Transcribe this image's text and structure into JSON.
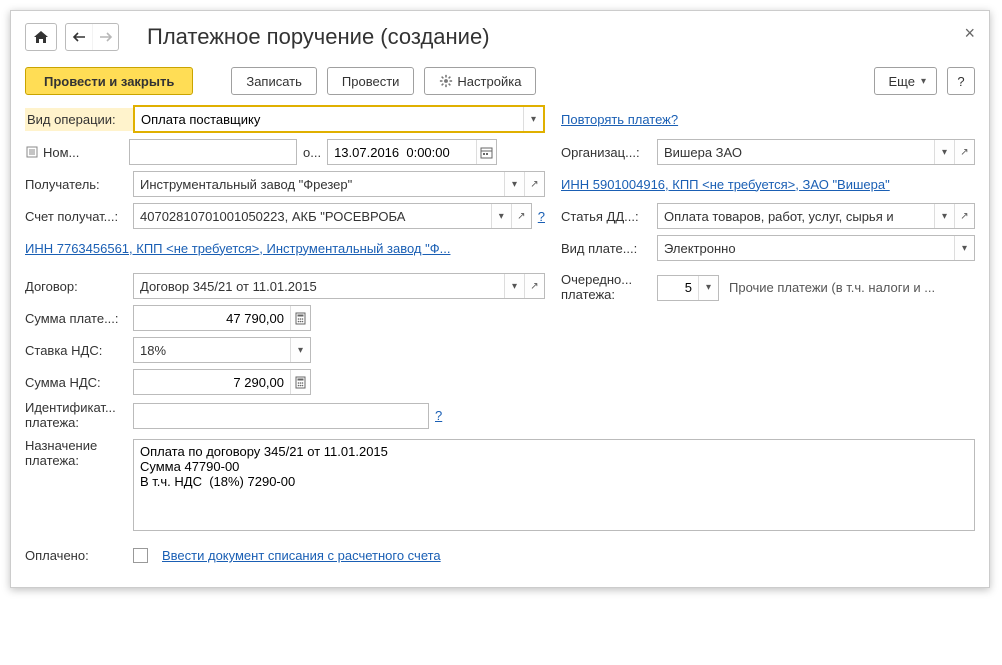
{
  "header": {
    "title": "Платежное поручение (создание)"
  },
  "toolbar": {
    "post_close": "Провести и закрыть",
    "save": "Записать",
    "post": "Провести",
    "settings": "Настройка",
    "more": "Еще",
    "help": "?"
  },
  "left": {
    "operation_label": "Вид операции:",
    "operation_value": "Оплата поставщику",
    "number_label": "Ном...",
    "number_value": "",
    "from_label": "о...",
    "date_value": "13.07.2016  0:00:00",
    "recipient_label": "Получатель:",
    "recipient_value": "Инструментальный завод \"Фрезер\"",
    "recipient_account_label": "Счет получат...:",
    "recipient_account_value": "40702810701001050223, АКБ \"РОСЕВРОБА",
    "recipient_link": "ИНН 7763456561, КПП <не требуется>, Инструментальный завод \"Ф...",
    "contract_label": "Договор:",
    "contract_value": "Договор 345/21 от 11.01.2015",
    "amount_label": "Сумма плате...:",
    "amount_value": "47 790,00",
    "vat_rate_label": "Ставка НДС:",
    "vat_rate_value": "18%",
    "vat_amount_label": "Сумма НДС:",
    "vat_amount_value": "7 290,00",
    "payment_id_label": "Идентификат... платежа:",
    "payment_id_value": "",
    "purpose_label": "Назначение платежа:",
    "purpose_value": "Оплата по договору 345/21 от 11.01.2015\nСумма 47790-00\nВ т.ч. НДС  (18%) 7290-00",
    "paid_label": "Оплачено:",
    "paid_link": "Ввести документ списания с расчетного счета"
  },
  "right": {
    "repeat_link": "Повторять платеж?",
    "org_label": "Организац...:",
    "org_value": "Вишера ЗАО",
    "org_link": "ИНН 5901004916, КПП <не требуется>, ЗАО \"Вишера\"",
    "dds_label": "Статья ДД...:",
    "dds_value": "Оплата товаров, работ, услуг, сырья и",
    "payment_type_label": "Вид плате...:",
    "payment_type_value": "Электронно",
    "priority_label": "Очередно... платежа:",
    "priority_value": "5",
    "priority_desc": "Прочие платежи (в т.ч. налоги и ..."
  }
}
